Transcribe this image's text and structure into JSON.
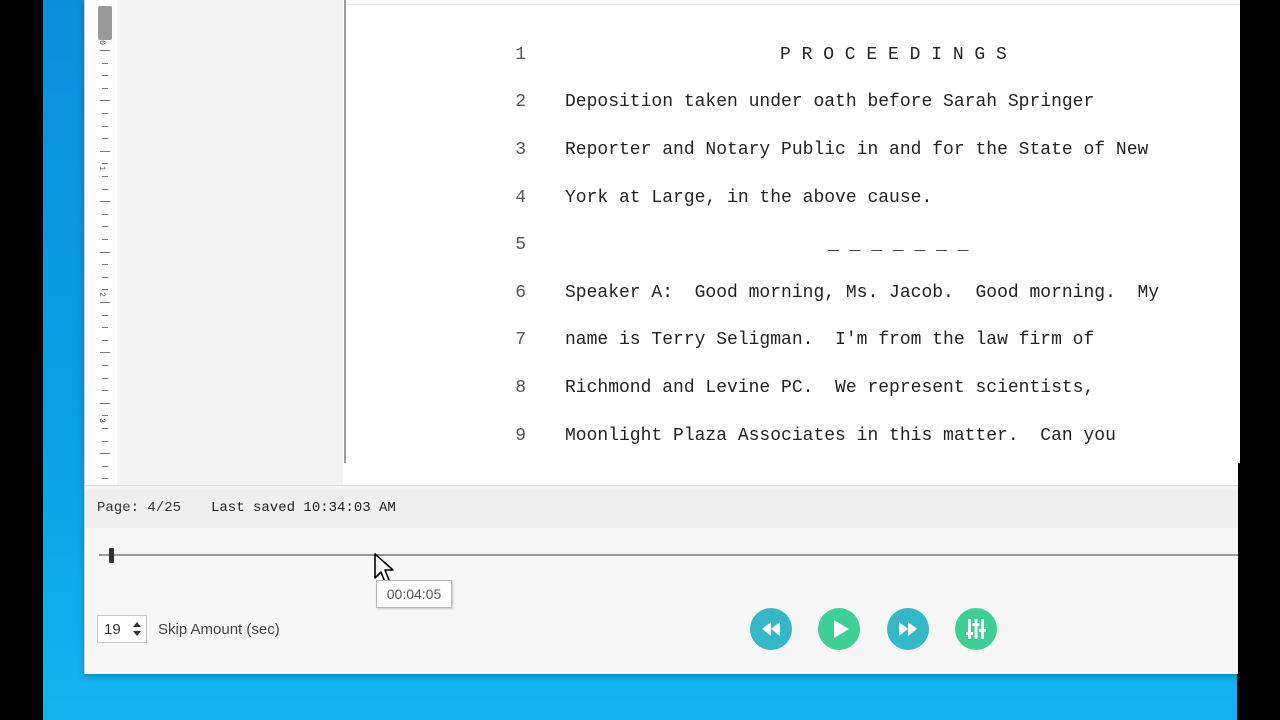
{
  "editor": {
    "ruler_numbers": [
      "0",
      "1",
      "2",
      "3"
    ],
    "lines": [
      {
        "num": "1",
        "text": "P R O C E E D I N G S",
        "centered": true
      },
      {
        "num": "2",
        "text": "Deposition taken under oath before Sarah Springer",
        "centered": false
      },
      {
        "num": "3",
        "text": "Reporter and Notary Public in and for the State of New",
        "centered": false
      },
      {
        "num": "4",
        "text": "York at Large, in the above cause.",
        "centered": false
      },
      {
        "num": "5",
        "text": "_ _ _ _ _ _ _",
        "centered": true
      },
      {
        "num": "6",
        "text": "Speaker A:  Good morning, Ms. Jacob.  Good morning.  My",
        "centered": false
      },
      {
        "num": "7",
        "text": "name is Terry Seligman.  I'm from the law firm of",
        "centered": false
      },
      {
        "num": "8",
        "text": "Richmond and Levine PC.  We represent scientists,",
        "centered": false
      },
      {
        "num": "9",
        "text": "Moonlight Plaza Associates in this matter.  Can you",
        "centered": false
      }
    ]
  },
  "status": {
    "page": "Page: 4/25",
    "saved": "Last saved 10:34:03 AM"
  },
  "player": {
    "tooltip_time": "00:04:05",
    "skip_amount_value": "19",
    "skip_amount_label": "Skip Amount (sec)",
    "buttons": {
      "rewind_icon": "rewind-icon",
      "play_icon": "play-icon",
      "forward_icon": "fast-forward-icon",
      "mixer_icon": "equalizer-icon"
    },
    "colors": {
      "teal": "#34b8c7",
      "green": "#3ecf95"
    }
  }
}
